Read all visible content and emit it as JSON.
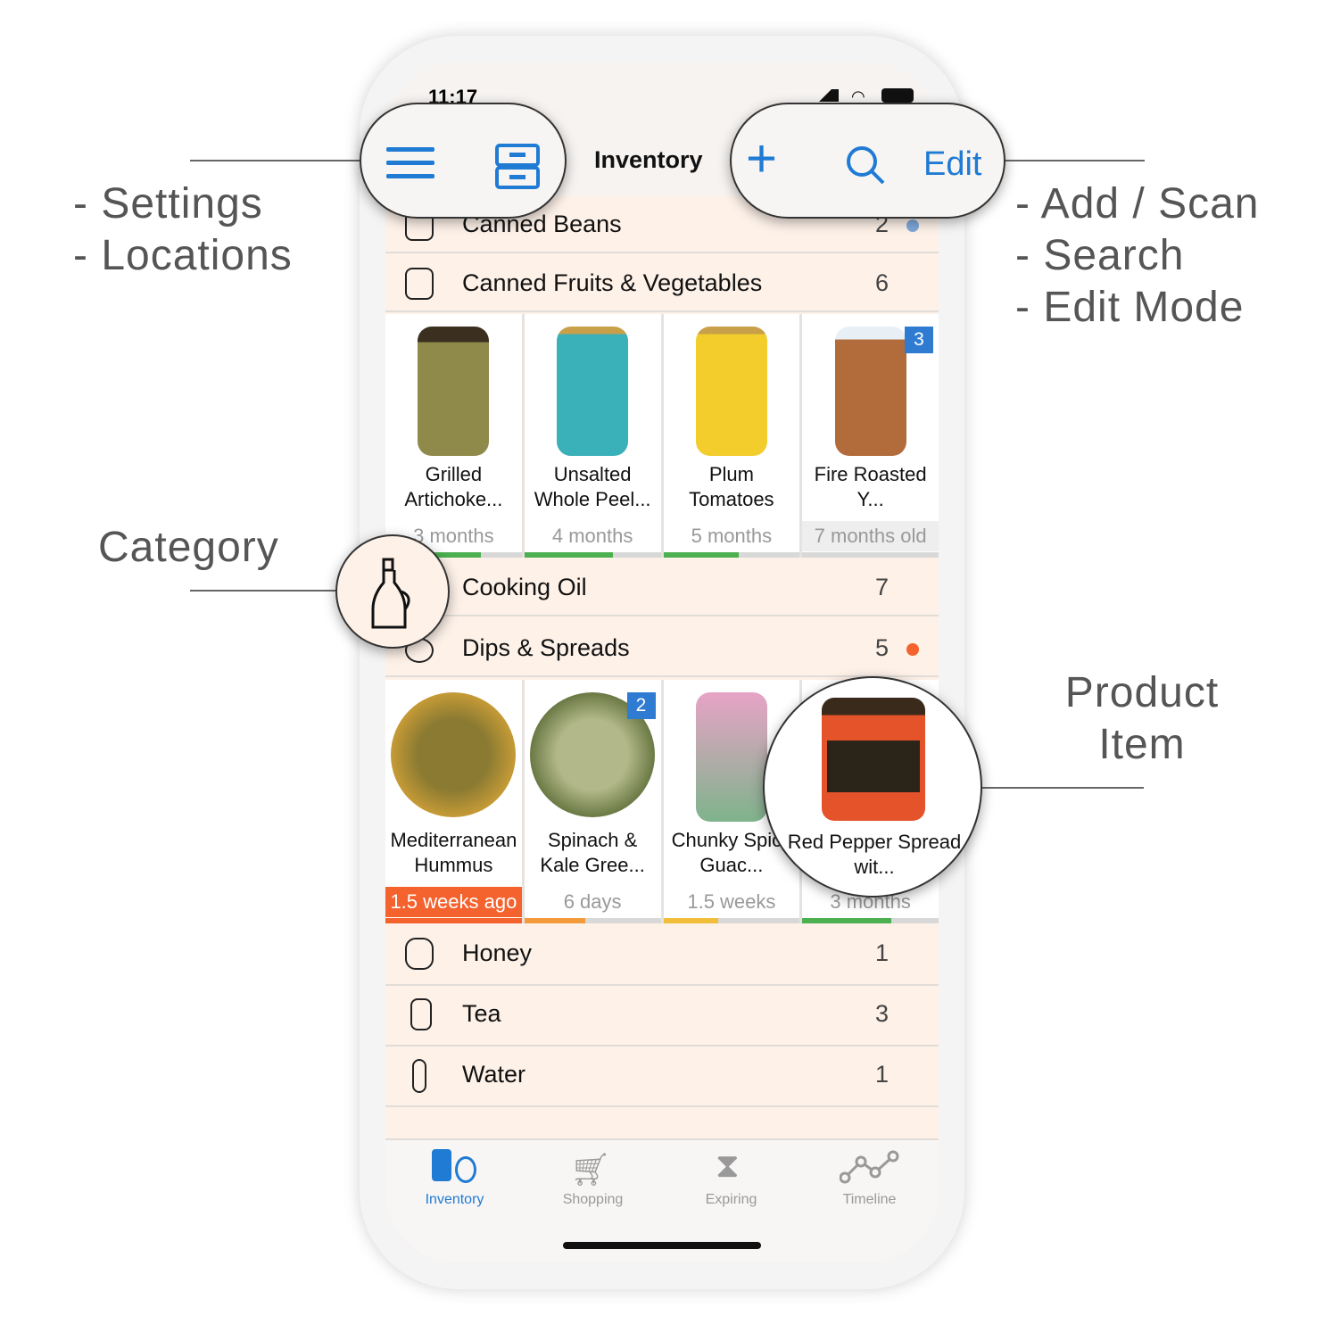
{
  "callouts": {
    "left_top": [
      "- Settings",
      "- Locations"
    ],
    "right_top": [
      "- Add / Scan",
      "- Search",
      "- Edit Mode"
    ],
    "category": "Category",
    "product": [
      "Product",
      "Item"
    ]
  },
  "status": {
    "time": "11:17"
  },
  "nav": {
    "title": "Inventory",
    "edit_label": "Edit",
    "menu_icon": "hamburger-icon",
    "locations_icon": "drawers-icon",
    "add_icon": "plus-icon",
    "search_icon": "search-icon"
  },
  "colors": {
    "accent": "#1f7bd3",
    "expired": "#f4622d",
    "green": "#4caf50",
    "orange": "#f39a3b",
    "yellow": "#f0be3a"
  },
  "categories": [
    {
      "label": "Canned Beans",
      "count": "2",
      "icon": "can-icon",
      "dot": "#7fa8d9"
    },
    {
      "label": "Canned Fruits & Vegetables",
      "count": "6",
      "icon": "jar-icon"
    },
    {
      "label": "Cooking Oil",
      "count": "7",
      "icon": "oil-bottle-icon"
    },
    {
      "label": "Dips & Spreads",
      "count": "5",
      "icon": "bowl-icon",
      "dot": "#f4622d"
    },
    {
      "label": "Honey",
      "count": "1",
      "icon": "honey-jar-icon"
    },
    {
      "label": "Tea",
      "count": "3",
      "icon": "tea-bag-icon"
    },
    {
      "label": "Water",
      "count": "1",
      "icon": "water-bottle-icon"
    }
  ],
  "products_canned": [
    {
      "name": "Grilled Artichoke...",
      "age": "3 months",
      "progress": 0.7,
      "bar_color": "#4caf50"
    },
    {
      "name": "Unsalted Whole Peel...",
      "age": "4 months",
      "progress": 0.65,
      "bar_color": "#4caf50"
    },
    {
      "name": "Plum Tomatoes",
      "age": "5 months",
      "progress": 0.55,
      "bar_color": "#4caf50"
    },
    {
      "name": "Fire Roasted Y...",
      "age": "7 months old",
      "progress": 0,
      "bar_color": "#4caf50",
      "badge": "3"
    }
  ],
  "products_dips": [
    {
      "name": "Mediterranean Hummus",
      "age": "1.5 weeks ago",
      "progress": 1,
      "bar_color": "#f4622d",
      "expired": true
    },
    {
      "name": "Spinach & Kale Gree...",
      "age": "6 days",
      "progress": 0.45,
      "bar_color": "#f39a3b",
      "badge": "2"
    },
    {
      "name": "Chunky Spicy Guac...",
      "age": "1.5 weeks",
      "progress": 0.4,
      "bar_color": "#f0be3a"
    },
    {
      "name": "Red Pepper Spread wit...",
      "age": "3 months",
      "progress": 0.65,
      "bar_color": "#4caf50"
    }
  ],
  "tabs": [
    {
      "label": "Inventory",
      "icon": "inventory-icon",
      "active": true
    },
    {
      "label": "Shopping",
      "icon": "cart-icon"
    },
    {
      "label": "Expiring",
      "icon": "hourglass-icon"
    },
    {
      "label": "Timeline",
      "icon": "timeline-icon"
    }
  ]
}
